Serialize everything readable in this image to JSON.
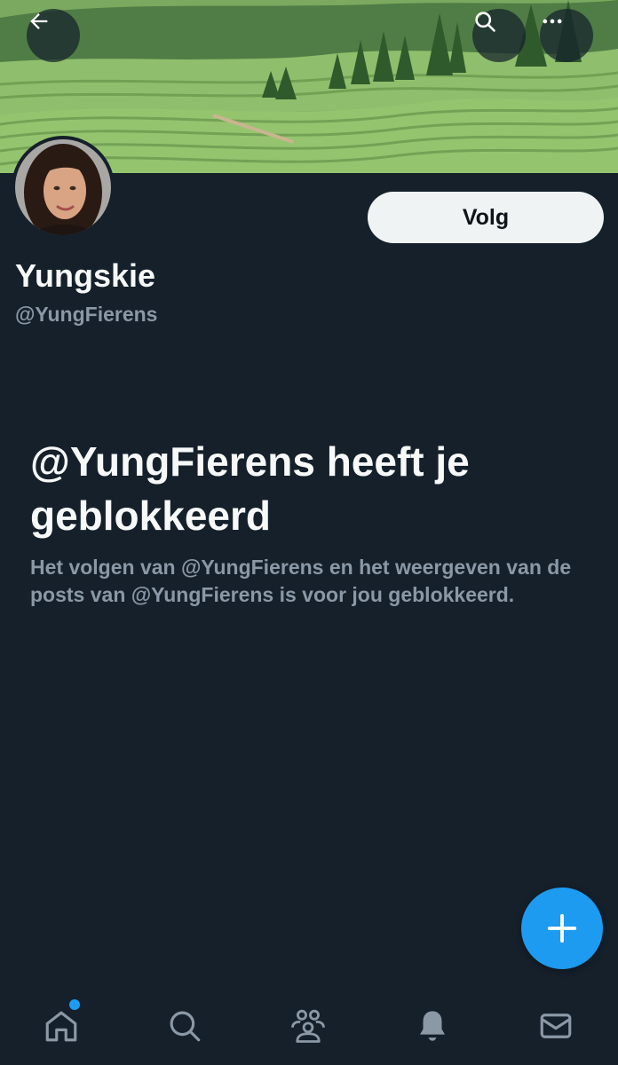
{
  "header": {
    "back_icon": "arrow-left-icon",
    "search_icon": "search-icon",
    "more_icon": "more-horizontal-icon"
  },
  "profile": {
    "display_name": "Yungskie",
    "handle": "@YungFierens",
    "follow_label": "Volg"
  },
  "blocked": {
    "title": "@YungFierens heeft je geblokkeerd",
    "description": "Het volgen van @YungFierens en het weergeven van de posts van @YungFierens is voor jou geblokkeerd."
  },
  "fab": {
    "icon": "plus-icon"
  },
  "bottom_nav": {
    "items": [
      {
        "icon": "home-icon",
        "has_notification": true
      },
      {
        "icon": "search-icon"
      },
      {
        "icon": "communities-icon"
      },
      {
        "icon": "bell-icon"
      },
      {
        "icon": "mail-icon"
      }
    ]
  },
  "colors": {
    "background": "#15202b",
    "accent": "#1d9bf0",
    "text_primary": "#f7f9f9",
    "text_secondary": "#8b98a5",
    "follow_button_bg": "#eff3f4"
  }
}
